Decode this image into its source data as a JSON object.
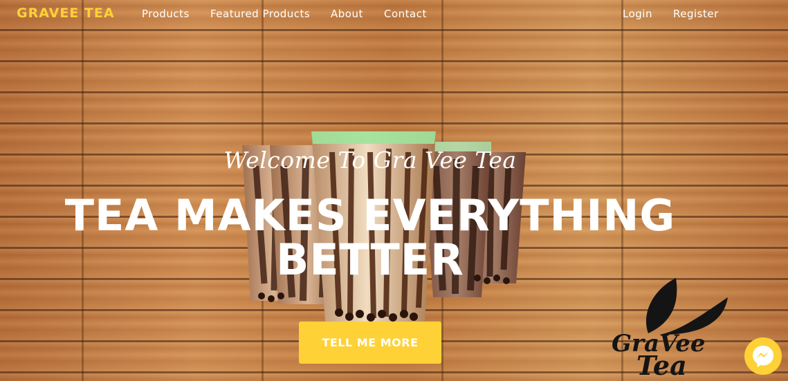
{
  "nav": {
    "brand": "GRAVEE TEA",
    "links": [
      "Products",
      "Featured Products",
      "About",
      "Contact"
    ],
    "login": "Login",
    "register": "Register"
  },
  "hero": {
    "subtitle": "Welcome To Gra Vee Tea",
    "title_line1": "TEA MAKES EVERYTHING",
    "title_line2": "BETTER",
    "cta_label": "TELL ME MORE"
  },
  "logo": {
    "text_line1": "GraVee",
    "text_line2": "Tea"
  },
  "colors": {
    "accent": "#fed136",
    "white": "#ffffff"
  },
  "icons": {
    "messenger": "messenger-icon",
    "logo": "leaf-logo-icon"
  }
}
